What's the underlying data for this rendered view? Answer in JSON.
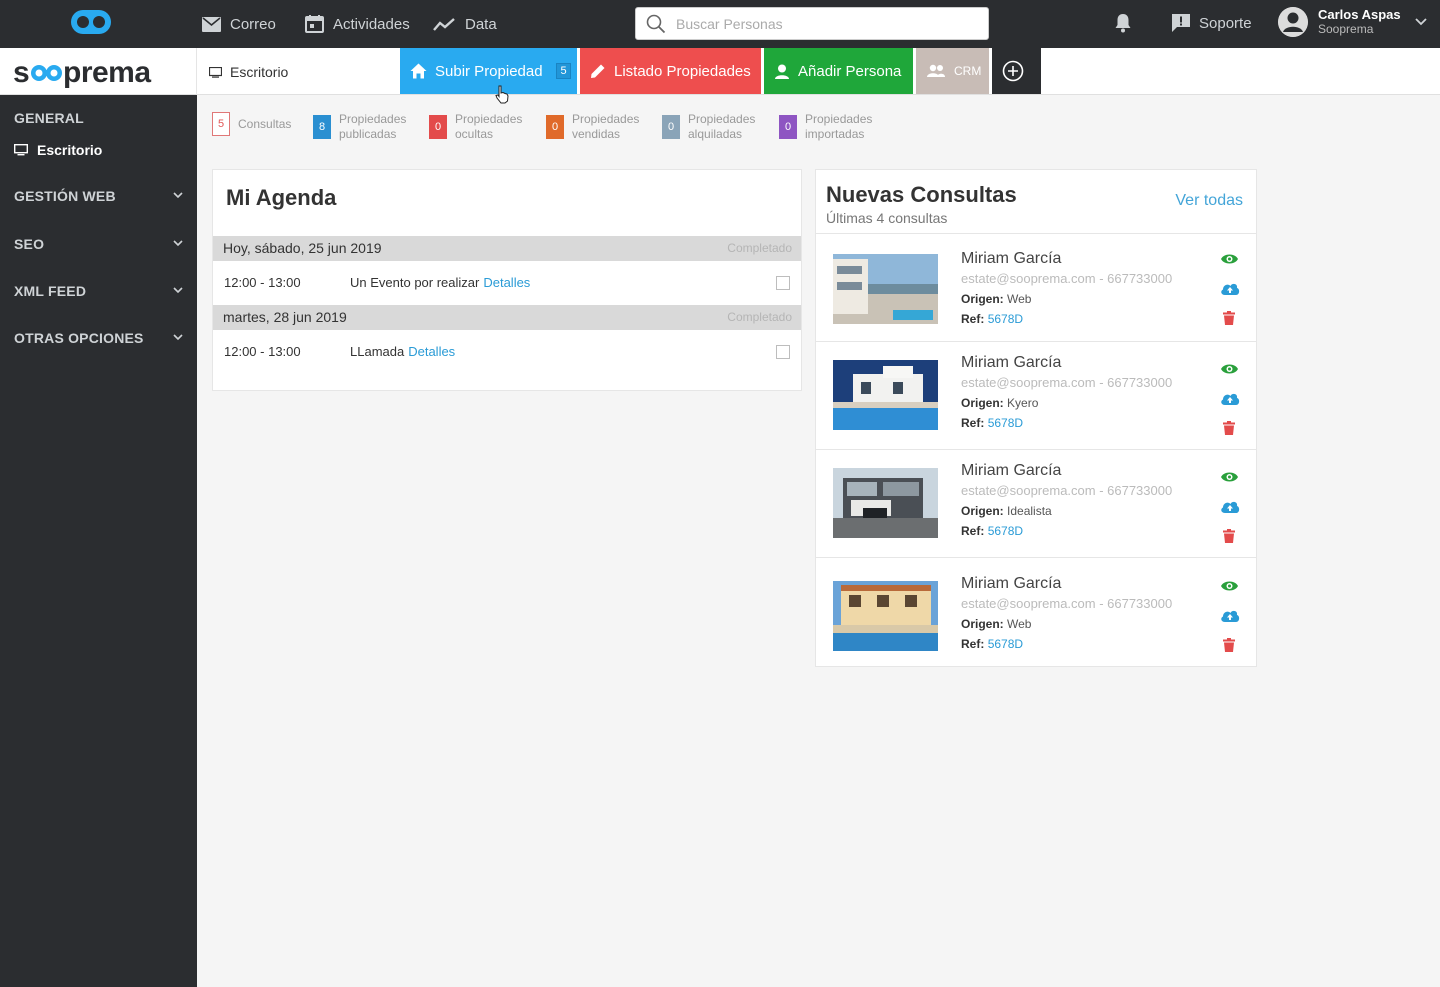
{
  "topbar": {
    "nav": [
      {
        "label": "Correo",
        "icon": "mail-icon"
      },
      {
        "label": "Actividades",
        "icon": "calendar-icon"
      },
      {
        "label": "Data",
        "icon": "chart-line-icon"
      }
    ],
    "search_placeholder": "Buscar Personas",
    "support_label": "Soporte",
    "user_name": "Carlos Aspas",
    "user_company": "Sooprema"
  },
  "subbar": {
    "brand": "sooprema",
    "crumb": "Escritorio",
    "actions": {
      "subir": "Subir Propiedad",
      "subir_count": "5",
      "listado": "Listado Propiedades",
      "anadir": "Añadir Persona",
      "crm": "CRM"
    }
  },
  "sidebar": {
    "general": "GENERAL",
    "escritorio": "Escritorio",
    "sections": [
      "GESTIÓN WEB",
      "SEO",
      "XML FEED",
      "OTRAS OPCIONES"
    ]
  },
  "stats": [
    {
      "count": "5",
      "label1": "Consultas",
      "label2": "",
      "color": "#ffffff"
    },
    {
      "count": "8",
      "label1": "Propiedades",
      "label2": "publicadas",
      "color": "#2a8fd1"
    },
    {
      "count": "0",
      "label1": "Propiedades",
      "label2": "ocultas",
      "color": "#e34b4b"
    },
    {
      "count": "0",
      "label1": "Propiedades",
      "label2": "vendidas",
      "color": "#e06a2a"
    },
    {
      "count": "0",
      "label1": "Propiedades",
      "label2": "alquiladas",
      "color": "#8aa4b8"
    },
    {
      "count": "0",
      "label1": "Propiedades",
      "label2": "importadas",
      "color": "#8e55c2"
    }
  ],
  "agenda": {
    "title": "Mi Agenda",
    "days": [
      {
        "label": "Hoy, sábado, 25 jun 2019",
        "status": "Completado",
        "events": [
          {
            "time": "12:00 - 13:00",
            "name": "Un Evento por realizar",
            "detail": "Detalles"
          }
        ]
      },
      {
        "label": "martes, 28 jun 2019",
        "status": "Completado",
        "events": [
          {
            "time": "12:00 - 13:00",
            "name": "LLamada",
            "detail": "Detalles"
          }
        ]
      }
    ]
  },
  "consultas": {
    "title": "Nuevas Consultas",
    "subtitle": "Últimas 4 consultas",
    "ver_todas": "Ver todas",
    "origin_label": "Origen:",
    "ref_label": "Ref:",
    "items": [
      {
        "name": "Miriam García",
        "contact": "estate@sooprema.com - 667733000",
        "origin": "Web",
        "ref": "5678D"
      },
      {
        "name": "Miriam García",
        "contact": "estate@sooprema.com - 667733000",
        "origin": "Kyero",
        "ref": "5678D"
      },
      {
        "name": "Miriam García",
        "contact": "estate@sooprema.com - 667733000",
        "origin": "Idealista",
        "ref": "5678D"
      },
      {
        "name": "Miriam García",
        "contact": "estate@sooprema.com - 667733000",
        "origin": "Web",
        "ref": "5678D"
      }
    ]
  }
}
